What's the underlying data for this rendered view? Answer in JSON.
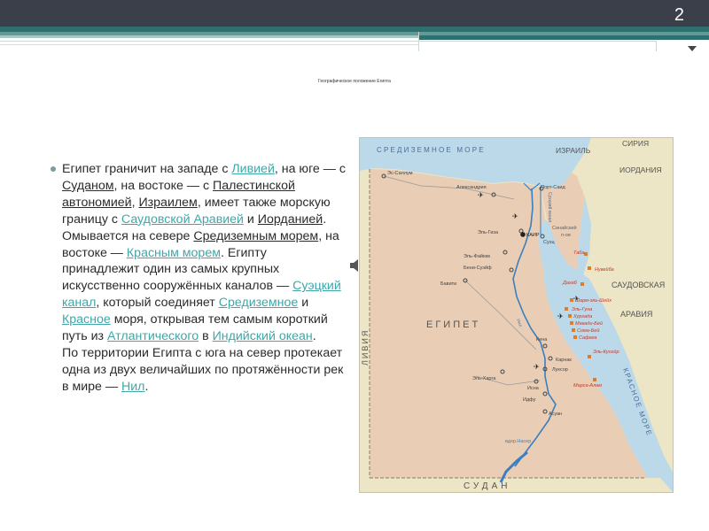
{
  "slide": {
    "number": "2",
    "title": "Географическое положение Египта"
  },
  "content": {
    "t1": "Египет граничит на западе с ",
    "l_libya": "Ливией",
    "t2": ", на юге — с ",
    "l_sudan": "Суданом",
    "t3": ", на востоке — с ",
    "l_palestine": "Палестинской автономией",
    "t4": ", ",
    "l_israel": "Израилем",
    "t5": ", имеет также морскую границу с ",
    "l_saudi": "Саудовской Аравией",
    "t6": " и ",
    "l_jordan": "Иорданией",
    "t7": ". Омывается на севере ",
    "l_med": "Средиземным морем",
    "t8": ", на востоке — ",
    "l_red": "Красным морем",
    "t9": ". Египту принадлежит один из самых крупных искусственно сооружённых каналов — ",
    "l_suez": "Суэцкий канал",
    "t10": ", который соединяет ",
    "l_med2": "Средиземное",
    "t11": " и ",
    "l_red2": "Красное",
    "t12": " моря, открывая тем самым короткий путь из ",
    "l_atl": "Атлантического",
    "t13": " в ",
    "l_ind": "Индийский океан",
    "t14": ".",
    "t15": "По территории Египта с юга на север протекает одна из двух величайших по протяжённости рек в мире — ",
    "l_nile": "Нил",
    "t16": "."
  },
  "map": {
    "sea_med": "СРЕДИЗЕМНОЕ МОРЕ",
    "israel": "ИЗРАИЛЬ",
    "syria": "СИРИЯ",
    "jordan": "ИОРДАНИЯ",
    "saudi1": "САУДОВСКАЯ",
    "saudi2": "АРАВИЯ",
    "egypt": "ЕГИПЕТ",
    "libya": "ЛИВИЯ",
    "sudan": "СУДАН",
    "red_sea": "КРАСНОЕ МОРЕ",
    "suez_canal": "Суэцкий канал",
    "sinai1": "Синайский",
    "sinai2": "п-ов",
    "nile": "Нил",
    "nasser": "вдхр.Насер",
    "cities": [
      {
        "name": "Эс-Саллум"
      },
      {
        "name": "Александрия"
      },
      {
        "name": "Порт-Саид"
      },
      {
        "name": "Эль-Гиза"
      },
      {
        "name": "КАИР"
      },
      {
        "name": "Суэц"
      },
      {
        "name": "Эль-Файюм"
      },
      {
        "name": "Бени-Суэйф"
      },
      {
        "name": "Бавити"
      },
      {
        "name": "Кена"
      },
      {
        "name": "Карнак"
      },
      {
        "name": "Луксор"
      },
      {
        "name": "Эль-Харга"
      },
      {
        "name": "Исна"
      },
      {
        "name": "Идфу"
      },
      {
        "name": "Асуан"
      }
    ],
    "resorts": [
      {
        "name": "Таба"
      },
      {
        "name": "Нувейба"
      },
      {
        "name": "Дахаб"
      },
      {
        "name": "Шарм-эль-Шейх"
      },
      {
        "name": "Эль-Гуна"
      },
      {
        "name": "Хургада"
      },
      {
        "name": "Макади-Бей"
      },
      {
        "name": "Сома-Бей"
      },
      {
        "name": "Сафага"
      },
      {
        "name": "Эль-Кусейр"
      },
      {
        "name": "Марса-Алам"
      }
    ]
  }
}
